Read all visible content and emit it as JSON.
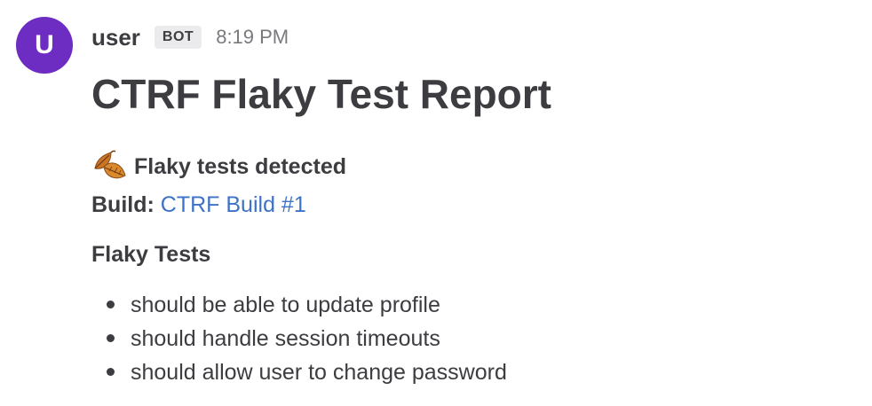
{
  "message": {
    "avatar_initial": "U",
    "avatar_color": "#6d2cc2",
    "username": "user",
    "badge": "BOT",
    "timestamp": "8:19 PM"
  },
  "report": {
    "title": "CTRF Flaky Test Report",
    "status_icon": "fallen-leaf-icon",
    "status_text": "Flaky tests detected",
    "build_label": "Build:",
    "build_link_text": "CTRF Build #1",
    "link_color": "#3d72c9",
    "section_heading": "Flaky Tests",
    "tests": [
      "should be able to update profile",
      "should handle session timeouts",
      "should allow user to change password"
    ]
  }
}
